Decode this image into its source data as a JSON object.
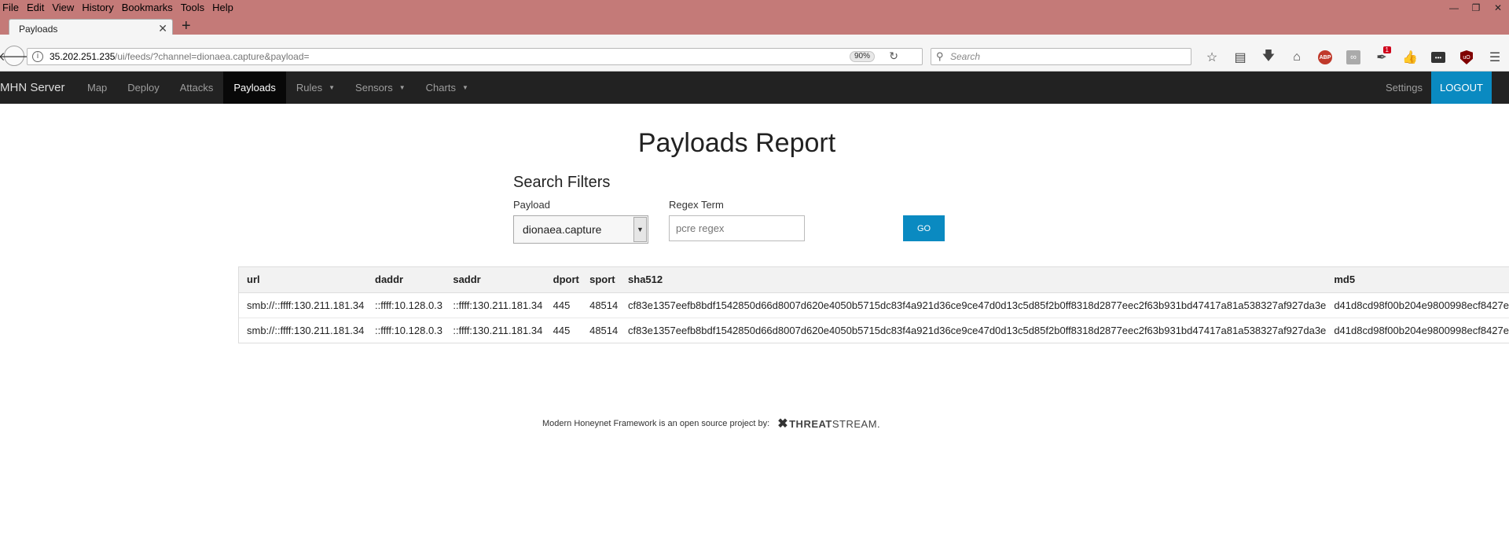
{
  "browser": {
    "menus": [
      "File",
      "Edit",
      "View",
      "History",
      "Bookmarks",
      "Tools",
      "Help"
    ],
    "tab_title": "Payloads",
    "url_host": "35.202.251.235",
    "url_path": "/ui/feeds/?channel=dionaea.capture&payload=",
    "zoom": "90%",
    "search_placeholder": "Search",
    "notification_count": "1",
    "icons": [
      "bookmark-star-icon",
      "reading-list-icon",
      "download-icon",
      "home-icon",
      "adblock-plus-icon",
      "gray-extension-icon",
      "notification-extension-icon",
      "thumbs-up-icon",
      "dark-extension-icon",
      "ublock-icon",
      "hamburger-menu-icon"
    ]
  },
  "site_nav": {
    "brand": "MHN Server",
    "links": [
      {
        "label": "Map"
      },
      {
        "label": "Deploy"
      },
      {
        "label": "Attacks"
      },
      {
        "label": "Payloads"
      },
      {
        "label": "Rules"
      },
      {
        "label": "Sensors"
      },
      {
        "label": "Charts"
      }
    ],
    "active": "Payloads",
    "settings": "Settings",
    "logout": "LOGOUT"
  },
  "report": {
    "title": "Payloads Report",
    "filters_title": "Search Filters",
    "payload_label": "Payload",
    "payload_value": "dionaea.capture",
    "regex_label": "Regex Term",
    "regex_placeholder": "pcre regex",
    "go_label": "GO"
  },
  "table": {
    "headers": [
      "url",
      "daddr",
      "saddr",
      "dport",
      "sport",
      "sha512",
      "md5"
    ],
    "rows": [
      [
        "smb://::ffff:130.211.181.34",
        "::ffff:10.128.0.3",
        "::ffff:130.211.181.34",
        "445",
        "48514",
        "cf83e1357eefb8bdf1542850d66d8007d620e4050b5715dc83f4a921d36ce9ce47d0d13c5d85f2b0ff8318d2877eec2f63b931bd47417a81a538327af927da3e",
        "d41d8cd98f00b204e9800998ecf8427e"
      ],
      [
        "smb://::ffff:130.211.181.34",
        "::ffff:10.128.0.3",
        "::ffff:130.211.181.34",
        "445",
        "48514",
        "cf83e1357eefb8bdf1542850d66d8007d620e4050b5715dc83f4a921d36ce9ce47d0d13c5d85f2b0ff8318d2877eec2f63b931bd47417a81a538327af927da3e",
        "d41d8cd98f00b204e9800998ecf8427e"
      ]
    ]
  },
  "footer": {
    "text": "Modern Honeynet Framework is an open source project by:",
    "logo_bold": "THREAT",
    "logo_light": "STREAM."
  },
  "colors": {
    "titlebar": "#c47a78",
    "navbar_bg": "#222222",
    "accent": "#0a8ac1"
  }
}
